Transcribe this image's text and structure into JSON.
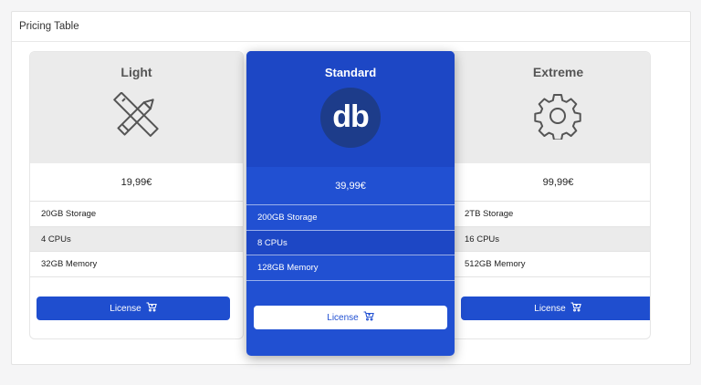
{
  "panel": {
    "title": "Pricing Table"
  },
  "plans": {
    "light": {
      "name": "Light",
      "icon": "pencil-ruler-icon",
      "price": "19,99€",
      "features": [
        "20GB Storage",
        "4 CPUs",
        "32GB Memory"
      ],
      "button_label": "License"
    },
    "standard": {
      "name": "Standard",
      "logo_text": "db",
      "price": "39,99€",
      "features": [
        "200GB Storage",
        "8 CPUs",
        "128GB Memory"
      ],
      "button_label": "License"
    },
    "extreme": {
      "name": "Extreme",
      "icon": "gear-icon",
      "price": "99,99€",
      "features": [
        "2TB Storage",
        "16 CPUs",
        "512GB Memory"
      ],
      "button_label": "License"
    }
  },
  "colors": {
    "accent": "#1f4ecf",
    "featured_bg": "#2150d2",
    "header_gray": "#ebebeb"
  }
}
